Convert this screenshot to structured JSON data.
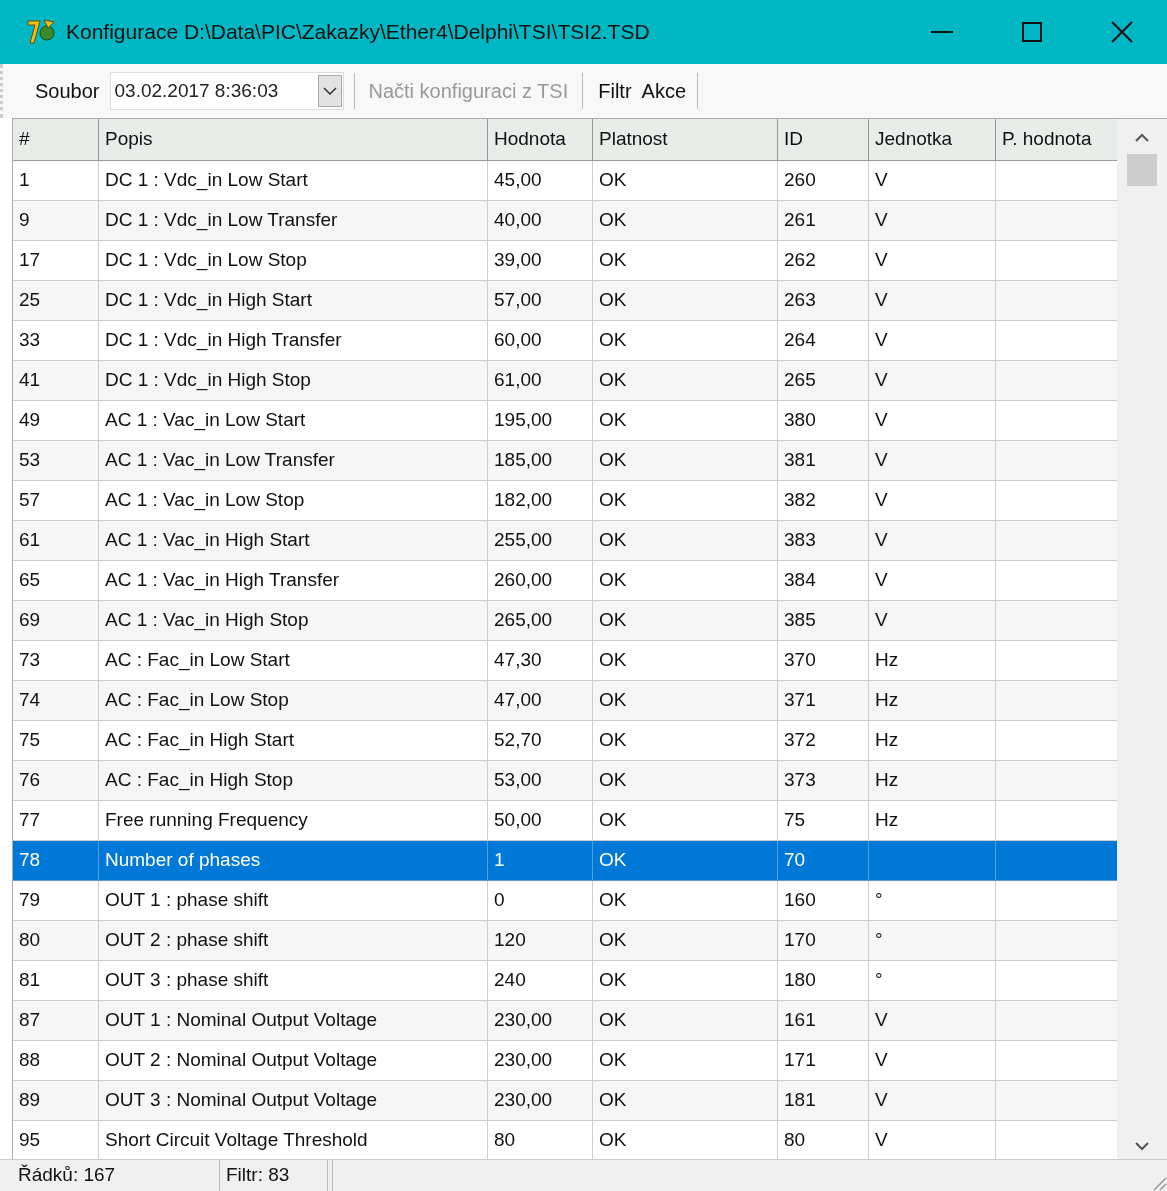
{
  "window": {
    "title": "Konfigurace D:\\Data\\PIC\\Zakazky\\Ether4\\Delphi\\TSI\\TSI2.TSD"
  },
  "toolbar": {
    "file_label": "Soubor",
    "file_value": "03.02.2017 8:36:03",
    "load_button": {
      "label": "Načti konfiguraci z TSI",
      "disabled": true
    },
    "menus": [
      "Filtr",
      "Akce"
    ]
  },
  "table": {
    "columns": [
      "#",
      "Popis",
      "Hodnota",
      "Platnost",
      "ID",
      "Jednotka",
      "P. hodnota"
    ],
    "rows": [
      {
        "cells": [
          "1",
          "DC 1 : Vdc_in Low Start",
          "45,00",
          "OK",
          "260",
          "V"
        ],
        "selected": false
      },
      {
        "cells": [
          "9",
          "DC 1 : Vdc_in Low Transfer",
          "40,00",
          "OK",
          "261",
          "V"
        ],
        "selected": false
      },
      {
        "cells": [
          "17",
          "DC 1 : Vdc_in Low Stop",
          "39,00",
          "OK",
          "262",
          "V"
        ],
        "selected": false
      },
      {
        "cells": [
          "25",
          "DC 1 : Vdc_in High Start",
          "57,00",
          "OK",
          "263",
          "V"
        ],
        "selected": false
      },
      {
        "cells": [
          "33",
          "DC 1 : Vdc_in High Transfer",
          "60,00",
          "OK",
          "264",
          "V"
        ],
        "selected": false
      },
      {
        "cells": [
          "41",
          "DC 1 : Vdc_in High Stop",
          "61,00",
          "OK",
          "265",
          "V"
        ],
        "selected": false
      },
      {
        "cells": [
          "49",
          "AC 1 : Vac_in Low Start",
          "195,00",
          "OK",
          "380",
          "V"
        ],
        "selected": false
      },
      {
        "cells": [
          "53",
          "AC 1 : Vac_in Low Transfer",
          "185,00",
          "OK",
          "381",
          "V"
        ],
        "selected": false
      },
      {
        "cells": [
          "57",
          "AC 1 : Vac_in Low Stop",
          "182,00",
          "OK",
          "382",
          "V"
        ],
        "selected": false
      },
      {
        "cells": [
          "61",
          "AC 1 : Vac_in High Start",
          "255,00",
          "OK",
          "383",
          "V"
        ],
        "selected": false
      },
      {
        "cells": [
          "65",
          "AC 1 : Vac_in High Transfer",
          "260,00",
          "OK",
          "384",
          "V"
        ],
        "selected": false
      },
      {
        "cells": [
          "69",
          "AC 1 : Vac_in High Stop",
          "265,00",
          "OK",
          "385",
          "V"
        ],
        "selected": false
      },
      {
        "cells": [
          "73",
          "AC : Fac_in Low Start",
          "47,30",
          "OK",
          "370",
          "Hz"
        ],
        "selected": false
      },
      {
        "cells": [
          "74",
          "AC : Fac_in Low Stop",
          "47,00",
          "OK",
          "371",
          "Hz"
        ],
        "selected": false
      },
      {
        "cells": [
          "75",
          "AC : Fac_in High Start",
          "52,70",
          "OK",
          "372",
          "Hz"
        ],
        "selected": false
      },
      {
        "cells": [
          "76",
          "AC : Fac_in High Stop",
          "53,00",
          "OK",
          "373",
          "Hz"
        ],
        "selected": false
      },
      {
        "cells": [
          "77",
          "Free running Frequency",
          "50,00",
          "OK",
          "75",
          "Hz"
        ],
        "selected": false
      },
      {
        "cells": [
          "78",
          "Number of phases",
          "1",
          "OK",
          "70"
        ],
        "selected": true
      },
      {
        "cells": [
          "79",
          "OUT 1 : phase shift",
          "0",
          "OK",
          "160",
          "°"
        ],
        "selected": false
      },
      {
        "cells": [
          "80",
          "OUT 2 : phase shift",
          "120",
          "OK",
          "170",
          "°"
        ],
        "selected": false
      },
      {
        "cells": [
          "81",
          "OUT 3 : phase shift",
          "240",
          "OK",
          "180",
          "°"
        ],
        "selected": false
      },
      {
        "cells": [
          "87",
          "OUT 1 : Nominal Output Voltage",
          "230,00",
          "OK",
          "161",
          "V"
        ],
        "selected": false
      },
      {
        "cells": [
          "88",
          "OUT 2 : Nominal Output Voltage",
          "230,00",
          "OK",
          "171",
          "V"
        ],
        "selected": false
      },
      {
        "cells": [
          "89",
          "OUT 3 : Nominal Output Voltage",
          "230,00",
          "OK",
          "181",
          "V"
        ],
        "selected": false
      },
      {
        "cells": [
          "95",
          "Short Circuit Voltage Threshold",
          "80",
          "OK",
          "80",
          "V"
        ],
        "selected": false
      }
    ]
  },
  "status_bar": [
    "Řádků: 167",
    "Filtr: 83"
  ]
}
